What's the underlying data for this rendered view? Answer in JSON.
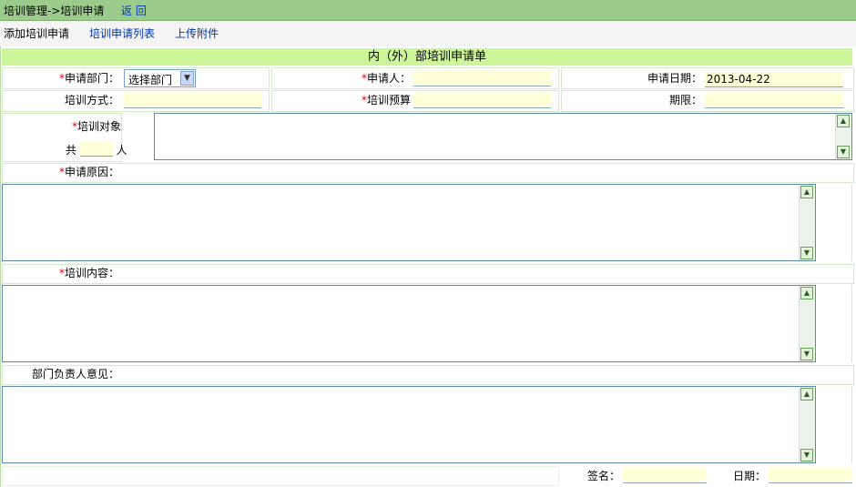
{
  "header": {
    "breadcrumb": "培训管理->培训申请",
    "back_label": "返 回"
  },
  "tabs": [
    {
      "label": "添加培训申请"
    },
    {
      "label": "培训申请列表"
    },
    {
      "label": "上传附件"
    }
  ],
  "form": {
    "title": "内（外）部培训申请单",
    "department": {
      "label": "申请部门：",
      "value": "选择部门"
    },
    "applicant": {
      "label": "申请人：",
      "value": ""
    },
    "apply_date": {
      "label": "申请日期：",
      "value": "2013-04-22"
    },
    "training_method": {
      "label": "培训方式：",
      "value": ""
    },
    "training_budget": {
      "label": "培训预算",
      "value": ""
    },
    "period": {
      "label": "期限：",
      "value": ""
    },
    "target": {
      "label": "培训对象",
      "total_prefix": "共",
      "total_suffix": "人",
      "count": ""
    },
    "reason": {
      "label": "申请原因："
    },
    "content": {
      "label": "培训内容："
    },
    "manager_opinion": {
      "label": "部门负责人意见："
    },
    "signature": {
      "label": "签名："
    },
    "date": {
      "label": "日期："
    },
    "required_mark": "*"
  },
  "icons": {
    "scroll_up": "scroll-up-icon",
    "scroll_down": "scroll-down-icon",
    "dropdown": "chevron-down-icon"
  },
  "colors": {
    "header_bg": "#9ccc8c",
    "title_bg": "#ccf59a",
    "input_bg": "#ffffd8",
    "required": "#e00000"
  }
}
